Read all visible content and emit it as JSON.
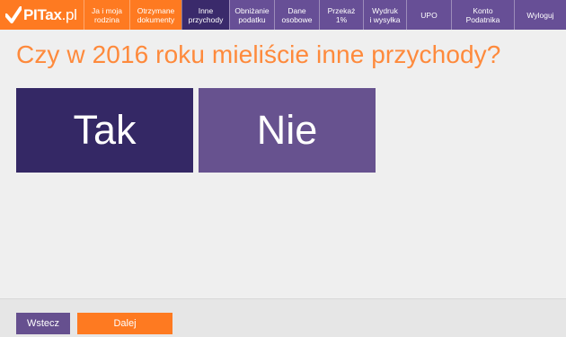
{
  "header": {
    "logo": {
      "check_icon": "checkmark-icon",
      "brand": "PITax",
      "suffix": ".pl"
    },
    "nav": [
      {
        "label": "Ja i moja\nrodzina",
        "state": "default"
      },
      {
        "label": "Otrzymane\ndokumenty",
        "state": "default"
      },
      {
        "label": "Inne\nprzychody",
        "state": "active"
      },
      {
        "label": "Obniżanie\npodatku",
        "state": "default"
      },
      {
        "label": "Dane\nosobowe",
        "state": "default"
      },
      {
        "label": "Przekaż\n1%",
        "state": "default"
      },
      {
        "label": "Wydruk\ni wysyłka",
        "state": "default"
      },
      {
        "label": "UPO",
        "state": "default"
      },
      {
        "label": "Konto\nPodatnika",
        "state": "default"
      },
      {
        "label": "Wyloguj",
        "state": "default"
      }
    ]
  },
  "main": {
    "question": "Czy w 2016 roku mieliście inne przychody?",
    "options": {
      "yes": "Tak",
      "no": "Nie"
    }
  },
  "footer": {
    "back_label": "Wstecz",
    "next_label": "Dalej"
  },
  "colors": {
    "orange": "#fe7a21",
    "dark_purple": "#342865",
    "purple": "#674f96",
    "question_text": "#fe8a3c"
  }
}
